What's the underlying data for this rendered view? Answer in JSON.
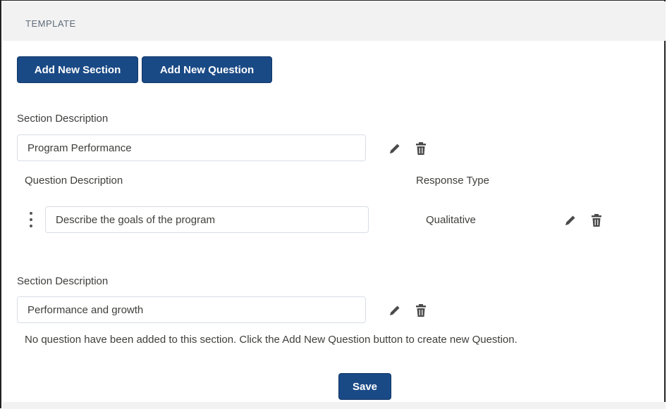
{
  "header": {
    "title": "TEMPLATE"
  },
  "toolbar": {
    "add_section_label": "Add New Section",
    "add_question_label": "Add New Question"
  },
  "sections": [
    {
      "description_label": "Section Description",
      "description_value": "Program Performance",
      "question_header": "Question Description",
      "response_header": "Response Type",
      "questions": [
        {
          "description": "Describe the goals of the program",
          "response_type": "Qualitative"
        }
      ]
    },
    {
      "description_label": "Section Description",
      "description_value": "Performance and growth",
      "empty_message": "No question have been added to this section. Click the Add New Question button to create new Question."
    }
  ],
  "actions": {
    "save_label": "Save"
  },
  "colors": {
    "primary": "#1a4a86",
    "header_bg": "#f2f2f2",
    "text": "#3e3e3c"
  },
  "icons": [
    "pencil-icon",
    "trash-icon",
    "drag-handle-icon"
  ]
}
